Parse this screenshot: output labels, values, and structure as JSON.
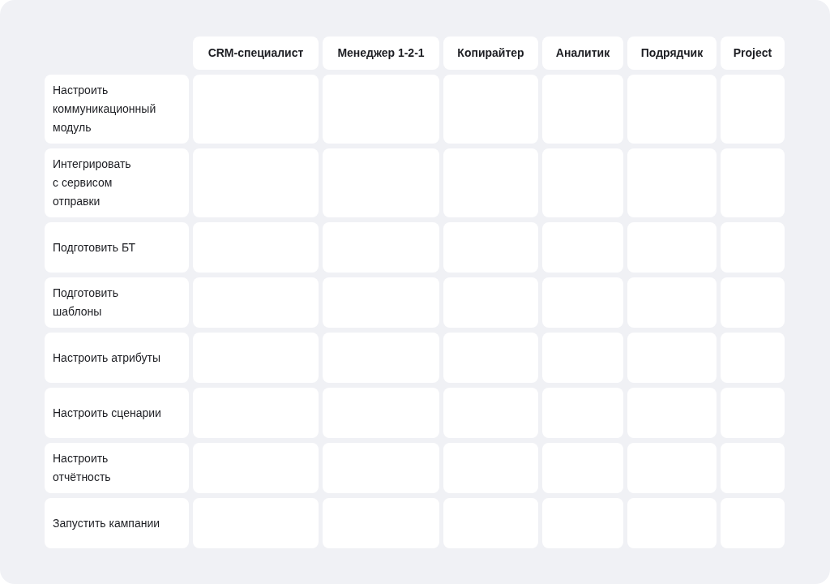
{
  "table": {
    "columns": [
      "CRM-специалист",
      "Менеджер 1-2-1",
      "Копирайтер",
      "Аналитик",
      "Подрядчик",
      "Project"
    ],
    "rows": [
      {
        "label": "Настроить\nкоммуникационный\nмодуль"
      },
      {
        "label": "Интегрировать\nс сервисом\nотправки"
      },
      {
        "label": "Подготовить БТ"
      },
      {
        "label": "Подготовить\nшаблоны"
      },
      {
        "label": "Настроить атрибуты"
      },
      {
        "label": "Настроить сценарии"
      },
      {
        "label": "Настроить\nотчётность"
      },
      {
        "label": "Запустить кампании"
      }
    ]
  }
}
